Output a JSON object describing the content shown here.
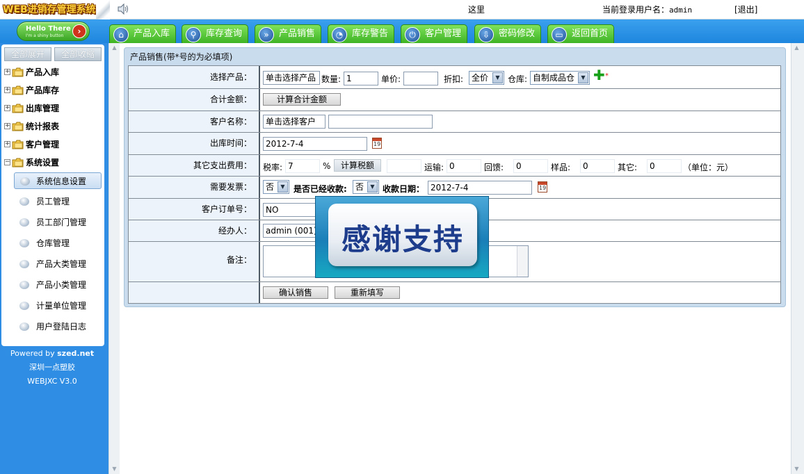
{
  "header": {
    "logo_text": "WEB进销存管理系统",
    "marquee_text": "这里",
    "user_label": "当前登录用户名：",
    "username": "admin",
    "logout": "[退出]"
  },
  "hello_button": {
    "line1": "Hello There",
    "line2": "I'm a shiny button"
  },
  "tabs": [
    {
      "label": "产品入库",
      "icon": "home-icon"
    },
    {
      "label": "库存查询",
      "icon": "search-icon"
    },
    {
      "label": "产品销售",
      "icon": "fast-forward-icon"
    },
    {
      "label": "库存警告",
      "icon": "rss-icon"
    },
    {
      "label": "客户管理",
      "icon": "power-icon"
    },
    {
      "label": "密码修改",
      "icon": "download-icon"
    },
    {
      "label": "返回首页",
      "icon": "monitor-icon"
    }
  ],
  "sidebar": {
    "expand_all": "全部展开",
    "collapse_all": "全部收缩",
    "nodes": [
      {
        "label": "产品入库",
        "expander": "+"
      },
      {
        "label": "产品库存",
        "expander": "+"
      },
      {
        "label": "出库管理",
        "expander": "+"
      },
      {
        "label": "统计报表",
        "expander": "+"
      },
      {
        "label": "客户管理",
        "expander": "+"
      },
      {
        "label": "系统设置",
        "expander": "−"
      }
    ],
    "sub_items": [
      "系统信息设置",
      "员工管理",
      "员工部门管理",
      "仓库管理",
      "产品大类管理",
      "产品小类管理",
      "计量单位管理",
      "用户登陆日志"
    ],
    "footer": {
      "powered_prefix": "Powered by ",
      "powered_site": "szed.net",
      "company": "深圳一点塑胶",
      "version": "WEBJXC V3.0"
    }
  },
  "panel": {
    "title": "产品销售(带*号的为必填项)"
  },
  "form": {
    "product": {
      "label": "选择产品：",
      "select_button": "单击选择产品",
      "qty_label": "数量:",
      "qty_value": "1",
      "price_label": "单价:",
      "price_value": "",
      "discount_label": "折扣:",
      "discount_value": "全价",
      "warehouse_label": "仓库:",
      "warehouse_value": "自制成品仓",
      "required_mark": "*"
    },
    "total": {
      "label": "合计金额：",
      "button": "计算合计金额"
    },
    "customer": {
      "label": "客户名称：",
      "select_button": "单击选择客户",
      "value": ""
    },
    "out_date": {
      "label": "出库时间：",
      "value": "2012-7-4",
      "cal_icon_text": "19"
    },
    "other_costs": {
      "label": "其它支出费用：",
      "tax_label": "税率:",
      "tax_value": "7",
      "percent": "%",
      "calc_tax_button": "计算税额",
      "tax_amount": "",
      "shipping_label": "运输:",
      "shipping_value": "0",
      "rebate_label": "回馈:",
      "rebate_value": "0",
      "sample_label": "样品:",
      "sample_value": "0",
      "other_label": "其它:",
      "other_value": "0",
      "unit_note": "（单位：元）"
    },
    "invoice": {
      "label": "需要发票：",
      "invoice_value": "否",
      "received_label": "是否已经收款:",
      "received_value": "否",
      "pay_date_label": "收款日期：",
      "pay_date_value": "2012-7-4",
      "cal_icon_text": "19"
    },
    "order_no": {
      "label": "客户订单号：",
      "value": "NO"
    },
    "handler": {
      "label": "经办人：",
      "value": "admin (001)"
    },
    "remark": {
      "label": "备注：",
      "value": ""
    },
    "actions": {
      "confirm": "确认销售",
      "reset": "重新填写"
    }
  },
  "overlay": {
    "text": "感谢支持"
  }
}
